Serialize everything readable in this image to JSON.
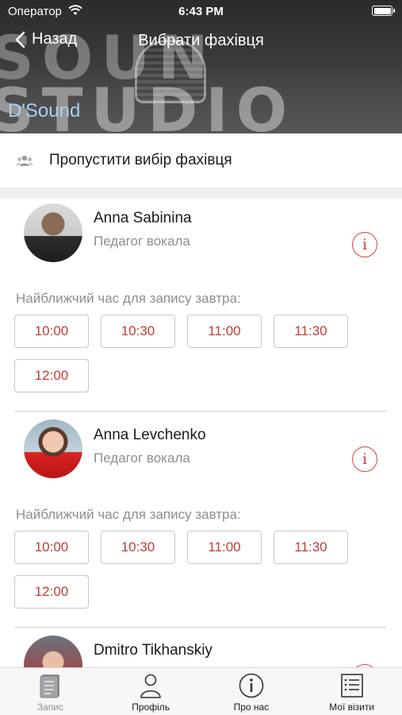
{
  "status_bar": {
    "carrier": "Оператор",
    "time": "6:43 PM"
  },
  "header": {
    "back_label": "Назад",
    "title": "Вибрати фахівця",
    "brand": "D'Sound",
    "banner_line_1": "SOUN",
    "banner_line_2": "STUDIO"
  },
  "skip": {
    "label": "Пропустити вибір фахівця",
    "icon": "group-icon"
  },
  "slots_caption": "Найближчий час для запису завтра:",
  "specialists": [
    {
      "name": "Anna Sabinina",
      "role": "Педагог вокала",
      "slots": [
        "10:00",
        "10:30",
        "11:00",
        "11:30",
        "12:00"
      ]
    },
    {
      "name": "Anna Levchenko",
      "role": "Педагог вокала",
      "slots": [
        "10:00",
        "10:30",
        "11:00",
        "11:30",
        "12:00"
      ]
    },
    {
      "name": "Dmitro Tikhanskiy"
    }
  ],
  "tabs": [
    {
      "label": "Запис",
      "icon": "booking-icon",
      "active": true
    },
    {
      "label": "Профіль",
      "icon": "profile-icon"
    },
    {
      "label": "Про нас",
      "icon": "info-icon"
    },
    {
      "label": "Мої візити",
      "icon": "visits-list-icon"
    }
  ],
  "colors": {
    "accent": "#d8403f",
    "brand": "#a9d1ef",
    "muted": "#8e8e93"
  }
}
